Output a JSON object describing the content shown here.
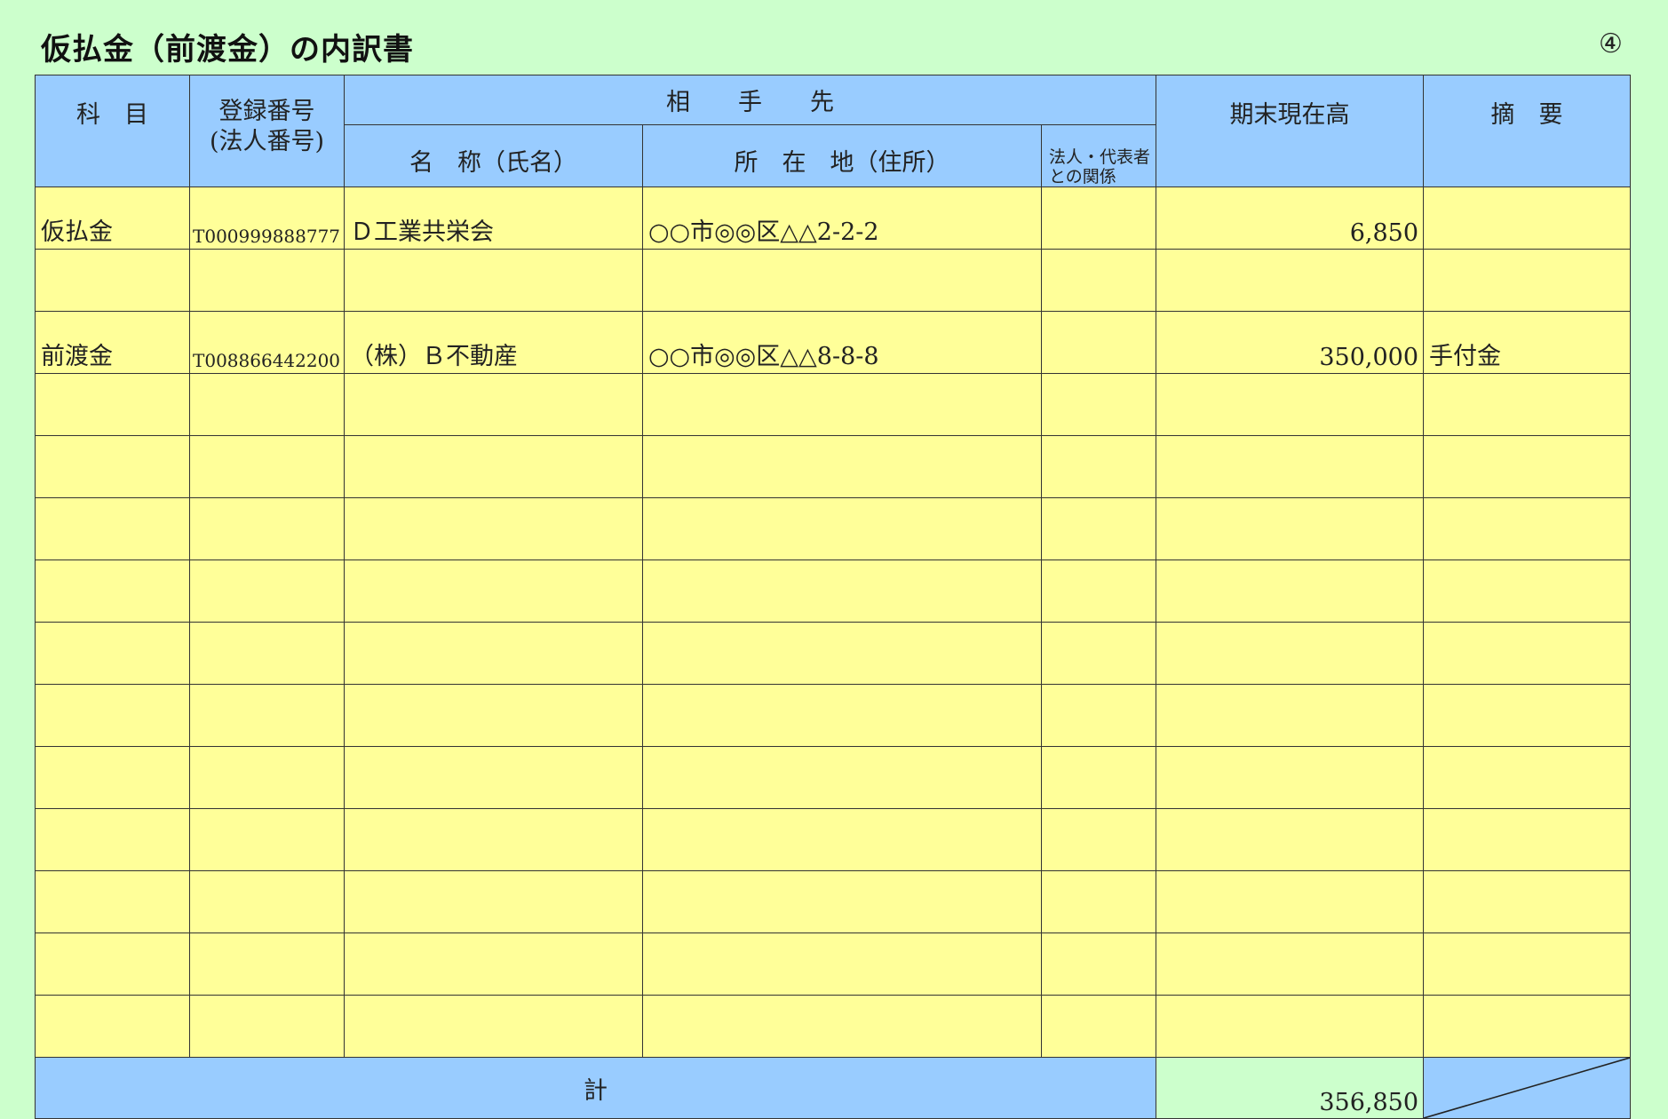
{
  "header": {
    "title": "仮払金（前渡金）の内訳書",
    "page_number": "④"
  },
  "table": {
    "columns": {
      "kamoku": "科　目",
      "registration": "登録番号",
      "registration_sub": "(法人番号)",
      "counterparty": "相　　手　　先",
      "name": "名　称（氏名）",
      "address": "所　在　地（住所）",
      "relation": "法人・代表者との関係",
      "balance": "期末現在高",
      "memo": "摘　要"
    },
    "rows": [
      {
        "kamoku": "仮払金",
        "registration": "T000999888777",
        "name": "Ｄ工業共栄会",
        "address": "○○市◎◎区△△2-2-2",
        "relation": "",
        "balance": "6,850",
        "memo": ""
      },
      {
        "kamoku": "",
        "registration": "",
        "name": "",
        "address": "",
        "relation": "",
        "balance": "",
        "memo": ""
      },
      {
        "kamoku": "前渡金",
        "registration": "T008866442200",
        "name": "（株）Ｂ不動産",
        "address": "○○市◎◎区△△8-8-8",
        "relation": "",
        "balance": "350,000",
        "memo": "手付金"
      },
      {
        "kamoku": "",
        "registration": "",
        "name": "",
        "address": "",
        "relation": "",
        "balance": "",
        "memo": ""
      },
      {
        "kamoku": "",
        "registration": "",
        "name": "",
        "address": "",
        "relation": "",
        "balance": "",
        "memo": ""
      },
      {
        "kamoku": "",
        "registration": "",
        "name": "",
        "address": "",
        "relation": "",
        "balance": "",
        "memo": ""
      },
      {
        "kamoku": "",
        "registration": "",
        "name": "",
        "address": "",
        "relation": "",
        "balance": "",
        "memo": ""
      },
      {
        "kamoku": "",
        "registration": "",
        "name": "",
        "address": "",
        "relation": "",
        "balance": "",
        "memo": ""
      },
      {
        "kamoku": "",
        "registration": "",
        "name": "",
        "address": "",
        "relation": "",
        "balance": "",
        "memo": ""
      },
      {
        "kamoku": "",
        "registration": "",
        "name": "",
        "address": "",
        "relation": "",
        "balance": "",
        "memo": ""
      },
      {
        "kamoku": "",
        "registration": "",
        "name": "",
        "address": "",
        "relation": "",
        "balance": "",
        "memo": ""
      },
      {
        "kamoku": "",
        "registration": "",
        "name": "",
        "address": "",
        "relation": "",
        "balance": "",
        "memo": ""
      },
      {
        "kamoku": "",
        "registration": "",
        "name": "",
        "address": "",
        "relation": "",
        "balance": "",
        "memo": ""
      },
      {
        "kamoku": "",
        "registration": "",
        "name": "",
        "address": "",
        "relation": "",
        "balance": "",
        "memo": ""
      }
    ],
    "total": {
      "label": "計",
      "amount": "356,850"
    }
  },
  "colors": {
    "page_background": "#ccffcc",
    "header_background": "#99ccff",
    "input_cell_background": "#ffff99",
    "total_amount_background": "#ccffcc"
  }
}
